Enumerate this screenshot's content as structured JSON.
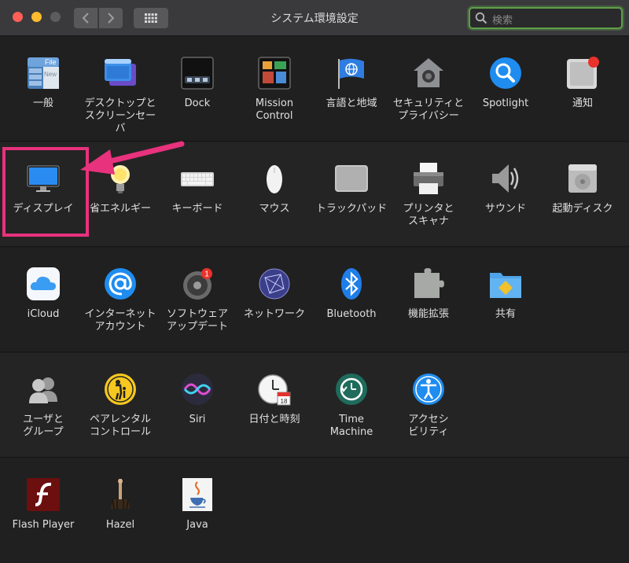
{
  "window": {
    "title": "システム環境設定",
    "search_placeholder": "検索"
  },
  "rows": [
    [
      {
        "label": "一般",
        "icon": "general-icon"
      },
      {
        "label": "デスクトップと\nスクリーンセーバ",
        "icon": "desktop-screensaver-icon"
      },
      {
        "label": "Dock",
        "icon": "dock-icon"
      },
      {
        "label": "Mission\nControl",
        "icon": "mission-control-icon"
      },
      {
        "label": "言語と地域",
        "icon": "language-region-icon"
      },
      {
        "label": "セキュリティと\nプライバシー",
        "icon": "security-privacy-icon"
      },
      {
        "label": "Spotlight",
        "icon": "spotlight-icon"
      },
      {
        "label": "通知",
        "icon": "notifications-icon"
      }
    ],
    [
      {
        "label": "ディスプレイ",
        "icon": "display-icon"
      },
      {
        "label": "省エネルギー",
        "icon": "energy-saver-icon"
      },
      {
        "label": "キーボード",
        "icon": "keyboard-icon"
      },
      {
        "label": "マウス",
        "icon": "mouse-icon"
      },
      {
        "label": "トラックパッド",
        "icon": "trackpad-icon"
      },
      {
        "label": "プリンタと\nスキャナ",
        "icon": "printer-scanner-icon"
      },
      {
        "label": "サウンド",
        "icon": "sound-icon"
      },
      {
        "label": "起動ディスク",
        "icon": "startup-disk-icon"
      }
    ],
    [
      {
        "label": "iCloud",
        "icon": "icloud-icon"
      },
      {
        "label": "インターネット\nアカウント",
        "icon": "internet-accounts-icon"
      },
      {
        "label": "ソフトウェア\nアップデート",
        "icon": "software-update-icon",
        "badge": "1"
      },
      {
        "label": "ネットワーク",
        "icon": "network-icon"
      },
      {
        "label": "Bluetooth",
        "icon": "bluetooth-icon"
      },
      {
        "label": "機能拡張",
        "icon": "extensions-icon"
      },
      {
        "label": "共有",
        "icon": "sharing-icon"
      }
    ],
    [
      {
        "label": "ユーザと\nグループ",
        "icon": "users-groups-icon"
      },
      {
        "label": "ペアレンタル\nコントロール",
        "icon": "parental-controls-icon"
      },
      {
        "label": "Siri",
        "icon": "siri-icon"
      },
      {
        "label": "日付と時刻",
        "icon": "date-time-icon"
      },
      {
        "label": "Time\nMachine",
        "icon": "time-machine-icon"
      },
      {
        "label": "アクセシ\nビリティ",
        "icon": "accessibility-icon"
      }
    ],
    [
      {
        "label": "Flash Player",
        "icon": "flash-player-icon"
      },
      {
        "label": "Hazel",
        "icon": "hazel-icon"
      },
      {
        "label": "Java",
        "icon": "java-icon"
      }
    ]
  ],
  "icon_texts": {
    "general_file": "File",
    "general_new": "New",
    "calendar_day": "18"
  },
  "colors": {
    "highlight": "#e8327d",
    "search_focus": "#5ea047"
  }
}
